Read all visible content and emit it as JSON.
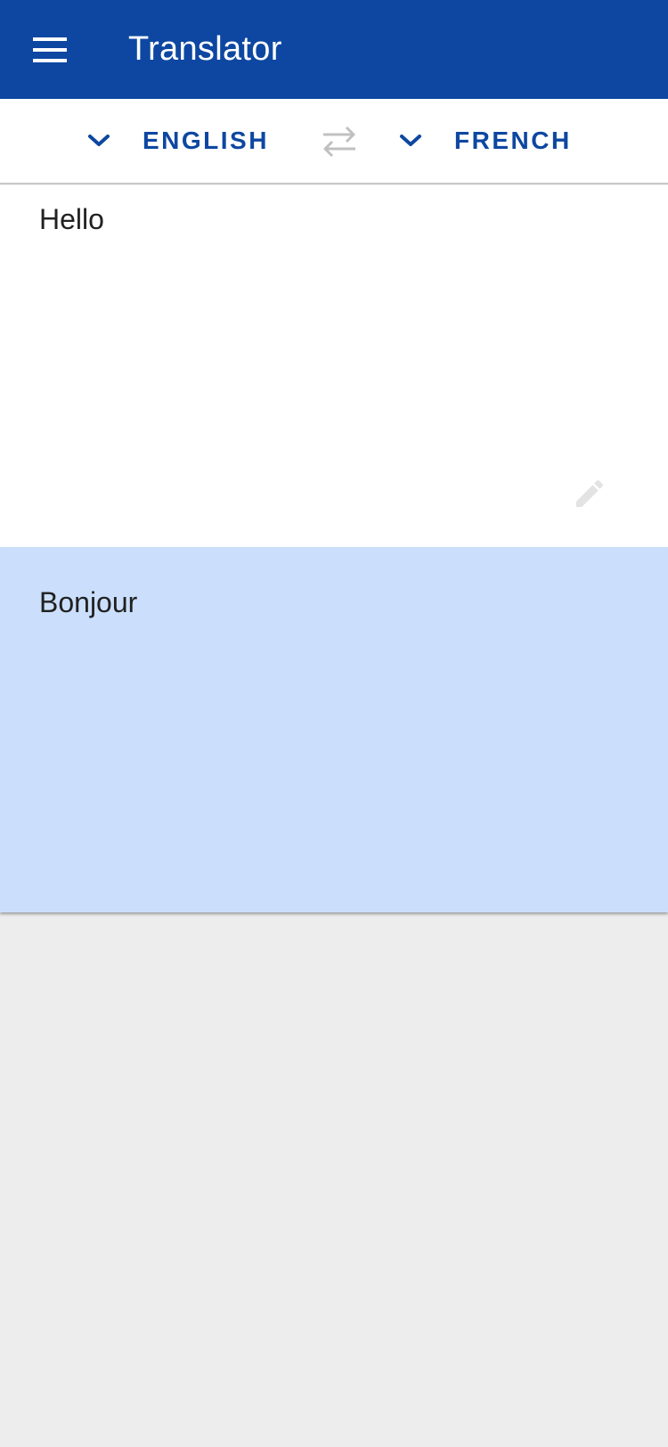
{
  "app_bar": {
    "title": "Translator",
    "menu_icon": "hamburger-menu-icon",
    "background": "#0d47a1"
  },
  "language_bar": {
    "source_language": "ENGLISH",
    "target_language": "FRENCH",
    "swap_icon": "swap-arrows-icon",
    "dropdown_icon": "chevron-down-icon",
    "accent": "#0d47a1"
  },
  "source_panel": {
    "text": "Hello",
    "edit_icon": "pencil-icon"
  },
  "result_panel": {
    "text": "Bonjour",
    "background": "#cbdffd"
  }
}
